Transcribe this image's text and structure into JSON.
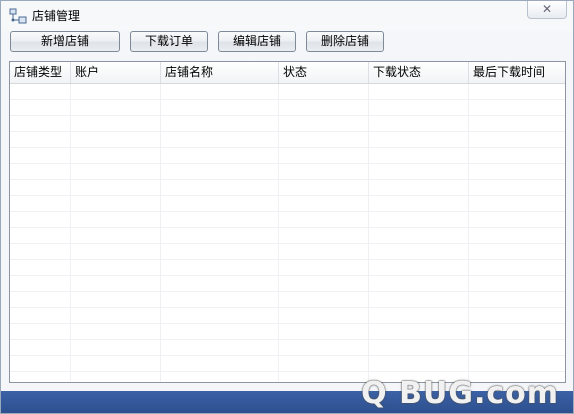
{
  "window": {
    "title": "店铺管理",
    "close_label": "✕"
  },
  "toolbar": {
    "add_label": "新增店铺",
    "download_label": "下载订单",
    "edit_label": "编辑店铺",
    "delete_label": "删除店铺"
  },
  "table": {
    "columns": [
      "店铺类型",
      "账户",
      "店铺名称",
      "状态",
      "下载状态",
      "最后下载时间"
    ],
    "rows": []
  },
  "watermark": {
    "text": "Q BUG.com"
  },
  "colors": {
    "statusbar": "#2d4f8e",
    "grid_border": "#8c96a3"
  }
}
